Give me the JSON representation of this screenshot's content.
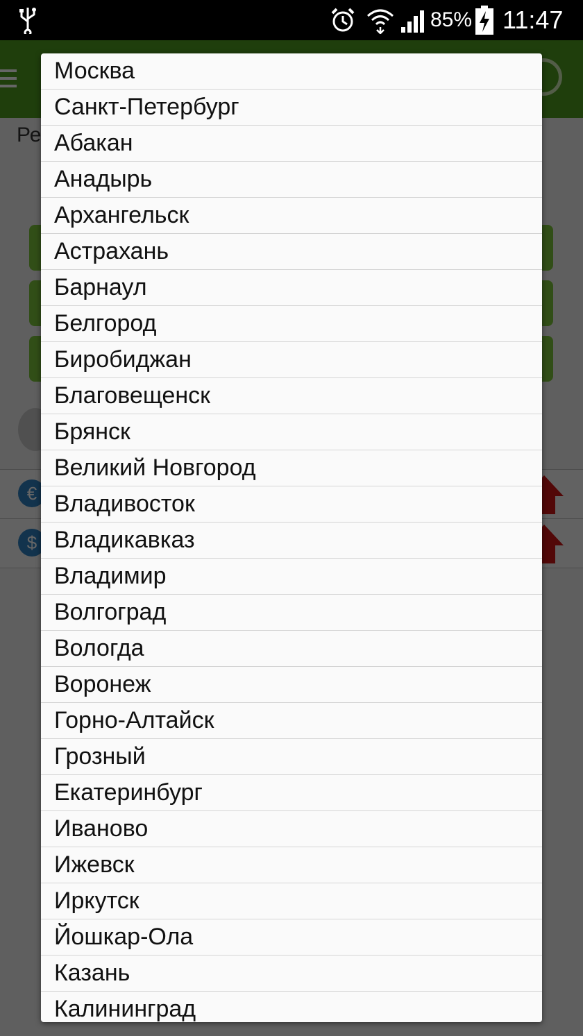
{
  "status_bar": {
    "battery_percent": "85%",
    "time": "11:47",
    "icons": [
      "usb-icon",
      "alarm-icon",
      "wifi-icon",
      "signal-icon",
      "battery-charging-icon"
    ]
  },
  "background": {
    "label_partial": "Ре",
    "row_icons": [
      "euro-coin-icon",
      "dollar-coin-icon"
    ],
    "euro_symbol": "€",
    "dollar_symbol": "$"
  },
  "dropdown": {
    "items": [
      "Москва",
      "Санкт-Петербург",
      "Абакан",
      "Анадырь",
      "Архангельск",
      "Астрахань",
      "Барнаул",
      "Белгород",
      "Биробиджан",
      "Благовещенск",
      "Брянск",
      "Великий Новгород",
      "Владивосток",
      "Владикавказ",
      "Владимир",
      "Волгоград",
      "Вологда",
      "Воронеж",
      "Горно-Алтайск",
      "Грозный",
      "Екатеринбург",
      "Иваново",
      "Ижевск",
      "Иркутск",
      "Йошкар-Ола",
      "Казань",
      "Калининград"
    ]
  }
}
